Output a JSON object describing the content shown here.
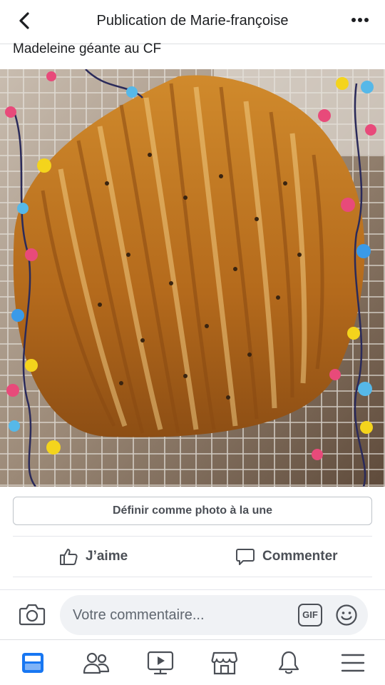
{
  "header": {
    "title": "Publication de Marie-françoise"
  },
  "post": {
    "caption": "Madeleine géante au CF"
  },
  "actions": {
    "featured_label": "Définir comme photo à la une",
    "like_label": "J’aime",
    "comment_label": "Commenter"
  },
  "composer": {
    "placeholder": "Votre commentaire...",
    "gif_label": "GIF"
  },
  "colors": {
    "brand": "#1877f2",
    "icon": "#4b4f56"
  },
  "tabs": [
    {
      "icon": "news-feed-icon",
      "active": true
    },
    {
      "icon": "groups-icon",
      "active": false
    },
    {
      "icon": "watch-icon",
      "active": false
    },
    {
      "icon": "marketplace-icon",
      "active": false
    },
    {
      "icon": "bell-icon",
      "active": false
    },
    {
      "icon": "menu-icon",
      "active": false
    }
  ]
}
